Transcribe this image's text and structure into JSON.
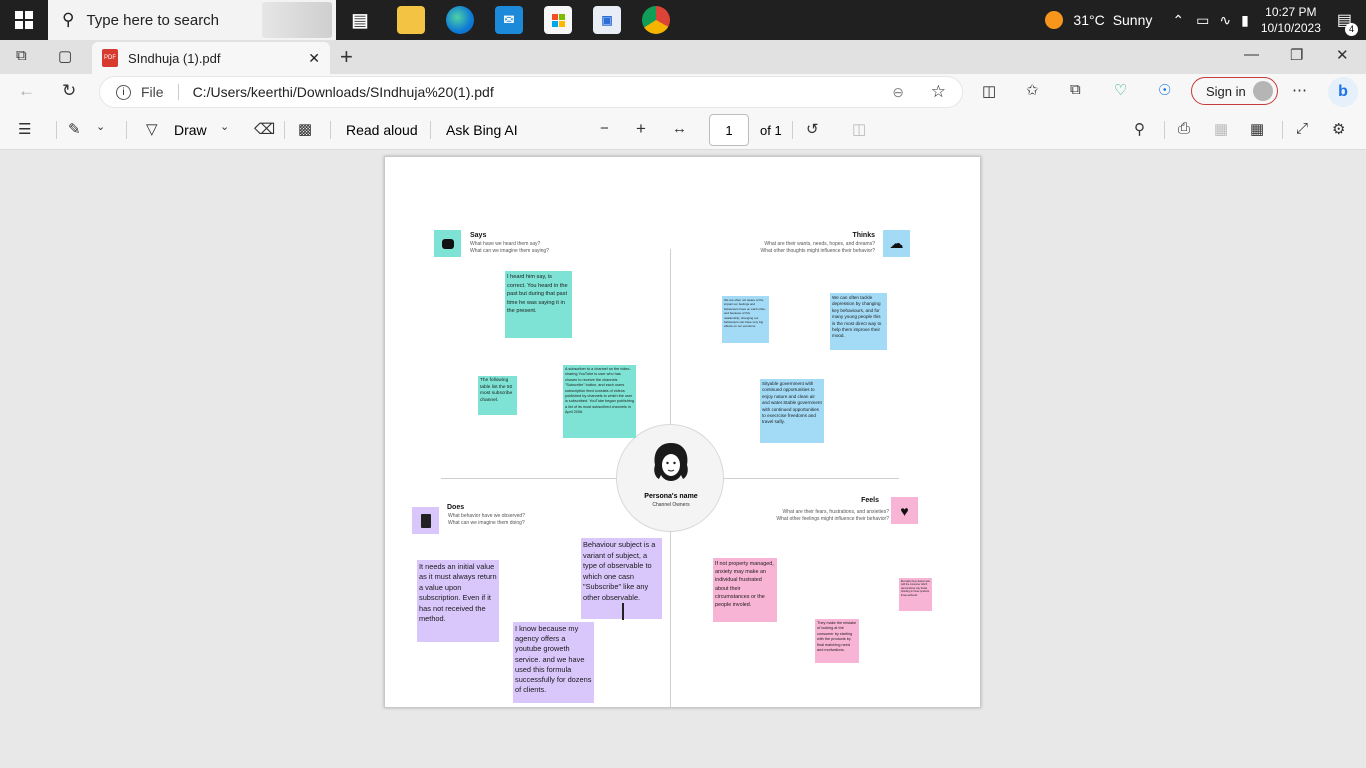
{
  "taskbar": {
    "search_placeholder": "Type here to search",
    "weather": {
      "temp": "31°C",
      "condition": "Sunny"
    },
    "clock": {
      "time": "10:27 PM",
      "date": "10/10/2023"
    },
    "notification_count": "4"
  },
  "browser": {
    "tab_title": "SIndhuja (1).pdf",
    "address_prefix": "File",
    "address": "C:/Users/keerthi/Downloads/SIndhuja%20(1).pdf",
    "sign_in": "Sign in"
  },
  "pdf_toolbar": {
    "draw": "Draw",
    "read_aloud": "Read aloud",
    "ask_bing": "Ask Bing AI",
    "page_number": "1",
    "page_total": "of 1"
  },
  "empathy_map": {
    "persona": {
      "name": "Persona's name",
      "role": "Channel Owners"
    },
    "says": {
      "title": "Says",
      "sub1": "What have we heard them say?",
      "sub2": "What can we imagine them saying?",
      "color": "#7ee3d4",
      "notes": [
        "I heard him say, is correct.  You heard in the past but during that  past time he was saying it in the present.",
        "The following table list  the 50 most  subscribe channel.",
        "A subscriber to a channel on the video-sharing YouTube is user who has chosen to receive the channels \"Subscribe\" button, and  each users subscription feed consists of videos published by  channels to which the user is subscribed. YouTube began publishing a list of its most subscribed channels in April 2006."
      ]
    },
    "thinks": {
      "title": "Thinks",
      "sub1": "What are their wants, needs, hopes, and dreams?",
      "sub2": "What other thoughts might influence their behavior?",
      "color": "#a3dbf7",
      "notes": [
        "We are often not aware of the impact our feelings and behaviours have on each other, and because of this relationship, changing our behaviours can have very big effects on our emotions.",
        "We can often tackle depression by changing key behaviours, and for many young people this is the most direct way to help them improve their mood.",
        "Sityable government with continued opportunities to enjoy nature and clean air and water.Stable government with continued opportunities to execrcise freedoms and travel safly."
      ]
    },
    "does": {
      "title": "Does",
      "sub1": "What behavior have we observed?",
      "sub2": "What can we imagine them doing?",
      "color": "#d9c6fb",
      "notes": [
        "It needs an initial value as it must always return a value upon subscription. Even if it has not received the method.",
        "Behaviour subject is a variant of subject, a type of observable to which one casn \"Subscribe\" like any other observable.",
        "I know because my agency offers a youtube groweth service. and we have used this formula successfully for dozens of clients."
      ]
    },
    "feels": {
      "title": "Feels",
      "sub1": "What are their fears, frustrations, and anxieties?",
      "sub2": "What other feelings might influence their behavior?",
      "color": "#f8b4d5",
      "notes": [
        "If not property managed, anxiety may make an individual frustrated about their circumstances or the people involed.",
        "They make the mistake of looking at the consumer by starting with the products by final matching need and motivations.",
        "But sadly they interpet care with the consumer which democratizes only brutal branding in those products those authentic."
      ]
    }
  }
}
